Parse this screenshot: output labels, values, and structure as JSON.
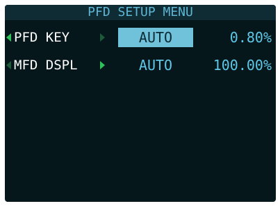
{
  "title": "PFD SETUP MENU",
  "rows": [
    {
      "label": "PFD KEY",
      "mode": "AUTO",
      "value": "0.80%",
      "selected": true
    },
    {
      "label": "MFD DSPL",
      "mode": "AUTO",
      "value": "100.00%",
      "selected": false
    }
  ],
  "colors": {
    "screen_bg": "#06171c",
    "title_bar_bg": "#0f2b34",
    "cyan_text": "#5fc8e8",
    "green_arrow": "#2ec35a",
    "selection_bg": "#6fc2da"
  },
  "icons": {
    "left_arrow": "triangle-left-icon",
    "right_arrow": "triangle-right-icon"
  }
}
